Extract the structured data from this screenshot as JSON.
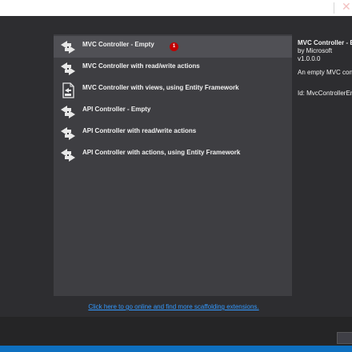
{
  "scaffold_list": {
    "items": [
      {
        "label": "MVC Controller - Empty",
        "icon": "mvc-controller-icon",
        "selected": true,
        "badge": "1"
      },
      {
        "label": "MVC Controller with read/write actions",
        "icon": "mvc-controller-icon"
      },
      {
        "label": "MVC Controller with views, using Entity Framework",
        "icon": "mvc-views-ef-icon"
      },
      {
        "label": "API Controller - Empty",
        "icon": "api-controller-icon"
      },
      {
        "label": "API Controller with read/write actions",
        "icon": "api-controller-icon"
      },
      {
        "label": "API Controller with actions, using Entity Framework",
        "icon": "api-controller-icon"
      }
    ]
  },
  "details": {
    "title": "MVC Controller - E",
    "author": "by Microsoft",
    "version": "v1.0.0.0",
    "description": "An empty MVC con",
    "id": "Id: MvcControllerEm"
  },
  "online_link": "Click here to go online and find more scaffolding extensions.",
  "colors": {
    "background": "#2d2d30",
    "list_background": "#3e3e42",
    "selected_row": "#505055",
    "link": "#3399ff",
    "badge": "#c00000",
    "status_bar": "#0e70c0"
  }
}
